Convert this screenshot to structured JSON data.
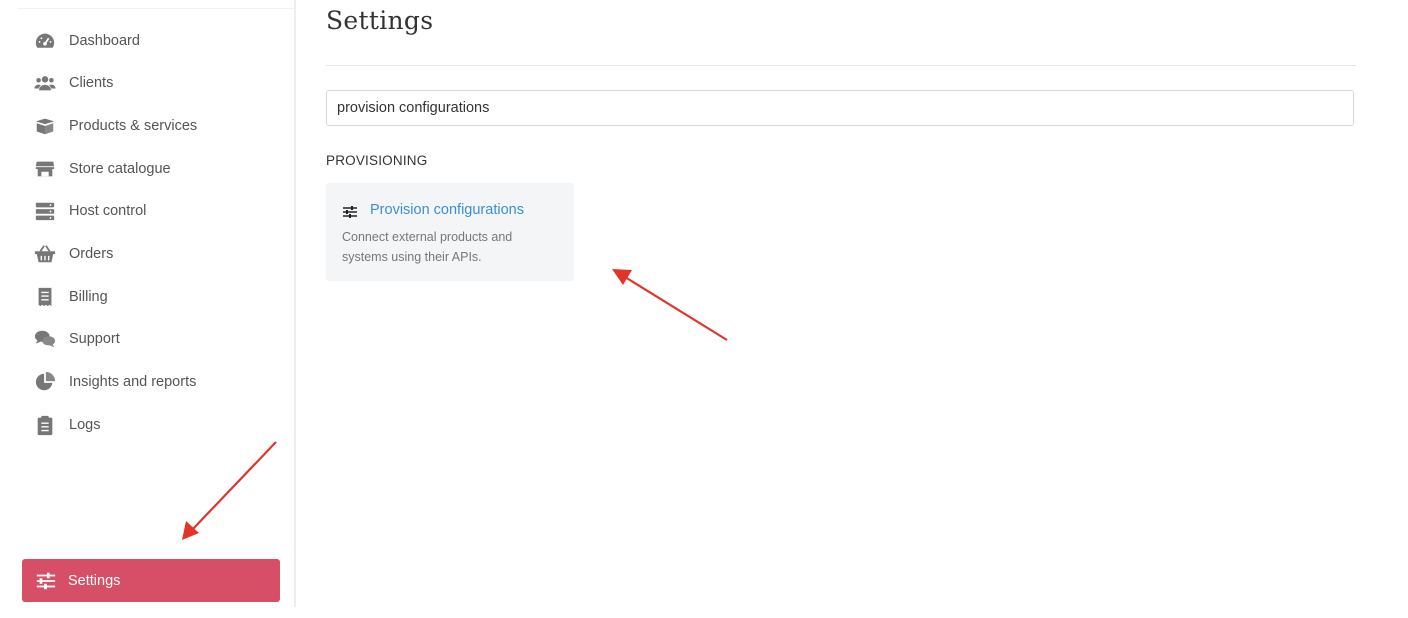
{
  "sidebar": {
    "items": [
      {
        "label": "Dashboard",
        "icon": "dashboard-gauge-icon"
      },
      {
        "label": "Clients",
        "icon": "users-icon"
      },
      {
        "label": "Products & services",
        "icon": "box-icon"
      },
      {
        "label": "Store catalogue",
        "icon": "store-icon"
      },
      {
        "label": "Host control",
        "icon": "server-icon"
      },
      {
        "label": "Orders",
        "icon": "basket-icon"
      },
      {
        "label": "Billing",
        "icon": "receipt-icon"
      },
      {
        "label": "Support",
        "icon": "chat-icon"
      },
      {
        "label": "Insights and reports",
        "icon": "pie-chart-icon"
      },
      {
        "label": "Logs",
        "icon": "clipboard-icon"
      }
    ],
    "active": {
      "label": "Settings",
      "icon": "sliders-icon",
      "color": "#d64f66"
    }
  },
  "main": {
    "title": "Settings",
    "search": {
      "value": "provision configurations",
      "placeholder": ""
    },
    "section_title": "PROVISIONING",
    "card": {
      "title": "Provision configurations",
      "description": "Connect external products and systems using their APIs.",
      "icon": "sliders-icon",
      "title_color": "#3b8fd6"
    }
  },
  "annotations": {
    "arrow_color": "#e2352a"
  }
}
